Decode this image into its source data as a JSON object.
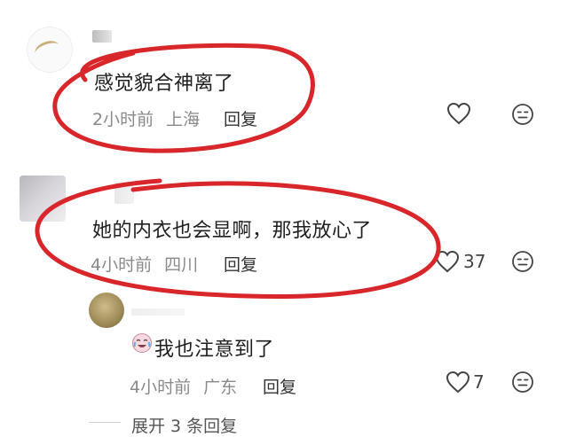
{
  "comments": [
    {
      "text": "感觉貌合神离了",
      "time": "2小时前",
      "location": "上海",
      "reply_label": "回复",
      "likes": ""
    },
    {
      "text": "她的内衣也会显啊，那我放心了",
      "time": "4小时前",
      "location": "四川",
      "reply_label": "回复",
      "likes": "37"
    }
  ],
  "reply": {
    "text": "我也注意到了",
    "time": "4小时前",
    "location": "广东",
    "reply_label": "回复",
    "likes": "7"
  },
  "expand_label": "展开 3 条回复",
  "colors": {
    "annotation_circle": "#d8262a",
    "meta_text": "#8a8a8a"
  },
  "icons": [
    "heart-icon",
    "neutral-face-icon",
    "crying-laugh-emoji"
  ]
}
